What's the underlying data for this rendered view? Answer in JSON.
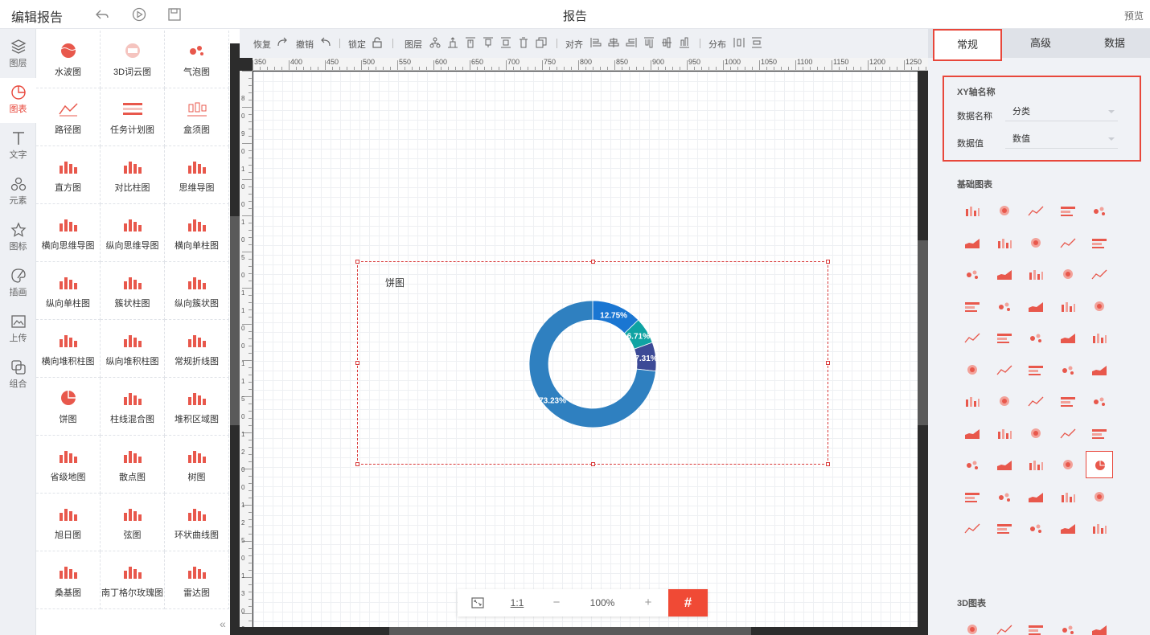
{
  "topbar": {
    "title": "编辑报告",
    "center": "报告",
    "preview": "预览"
  },
  "rail": [
    {
      "label": "图层",
      "icon": "layers-icon"
    },
    {
      "label": "图表",
      "icon": "pie-chart-icon"
    },
    {
      "label": "文字",
      "icon": "text-icon"
    },
    {
      "label": "元素",
      "icon": "shapes-icon"
    },
    {
      "label": "图标",
      "icon": "star-icon"
    },
    {
      "label": "插画",
      "icon": "palette-icon"
    },
    {
      "label": "上传",
      "icon": "upload-image-icon"
    },
    {
      "label": "组合",
      "icon": "group-icon"
    }
  ],
  "library": [
    "水波图",
    "3D词云图",
    "气泡图",
    "路径图",
    "任务计划图",
    "盒须图",
    "直方图",
    "对比柱图",
    "思维导图",
    "横向思维导图",
    "纵向思维导图",
    "横向单柱图",
    "纵向单柱图",
    "簇状柱图",
    "纵向簇状图",
    "横向堆积柱图",
    "纵向堆积柱图",
    "常规折线图",
    "饼图",
    "柱线混合图",
    "堆积区域图",
    "省级地图",
    "散点图",
    "树图",
    "旭日图",
    "弦图",
    "环状曲线图",
    "桑基图",
    "南丁格尔玫瑰图",
    "雷达图"
  ],
  "toolbar": {
    "redo": "恢复",
    "undo": "撤销",
    "lock": "锁定",
    "layer": "图层",
    "align": "对齐",
    "distribute": "分布"
  },
  "ruler_marks": [
    "350",
    "400",
    "450",
    "500",
    "550",
    "600",
    "650",
    "700",
    "750",
    "800",
    "850",
    "900",
    "950",
    "1000",
    "1050",
    "1100",
    "1150",
    "1200",
    "1250"
  ],
  "ruler_left_marks": [
    "8",
    "0",
    "9",
    "0",
    "1",
    "0",
    "0",
    "1",
    "0",
    "5",
    "0",
    "1",
    "1",
    "0",
    "0",
    "1",
    "1",
    "5",
    "0",
    "1",
    "2",
    "0",
    "0",
    "1",
    "2",
    "5",
    "0",
    "1",
    "3",
    "0",
    "0"
  ],
  "chart": {
    "title": "饼图",
    "slices": [
      {
        "label": "12.75%",
        "value": 12.75,
        "color": "#1a76d2"
      },
      {
        "label": "6.71%",
        "value": 6.71,
        "color": "#0fa3a3"
      },
      {
        "label": "7.31%",
        "value": 7.31,
        "color": "#3c4a96"
      },
      {
        "label": "73.23%",
        "value": 73.23,
        "color": "#2f80c0"
      }
    ]
  },
  "zoom": {
    "fit": "",
    "ratio": "1:1",
    "minus": "−",
    "level": "100%",
    "plus": "+",
    "grid": "#"
  },
  "rpanel": {
    "tabs": [
      "常规",
      "高级",
      "数据"
    ],
    "xy_title": "XY轴名称",
    "name_label": "数据名称",
    "name_value": "分类",
    "value_label": "数据值",
    "value_value": "数值",
    "basic_title": "基础图表",
    "threed_title": "3D图表"
  }
}
